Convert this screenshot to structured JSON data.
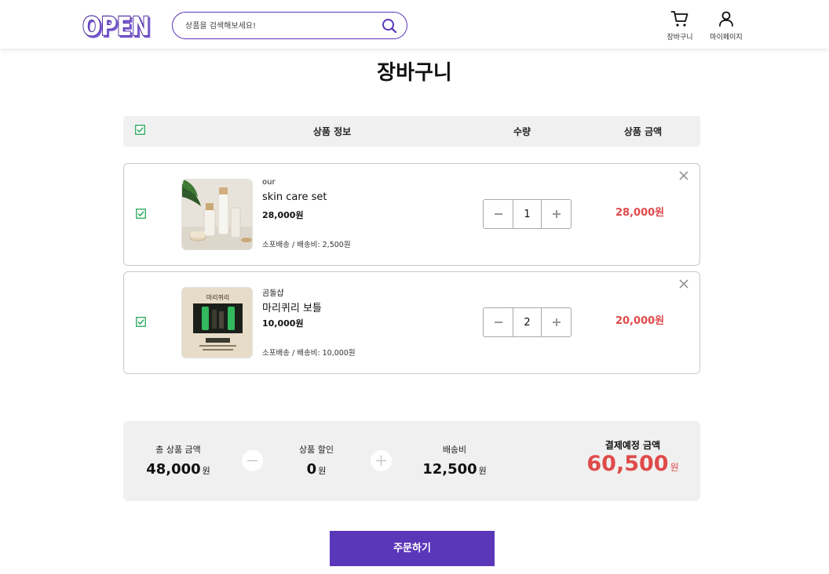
{
  "header": {
    "logo_text": "OPEN",
    "search": {
      "placeholder": "상품을 검색해보세요!",
      "value": ""
    },
    "cart_label": "장바구니",
    "mypage_label": "마이페이지"
  },
  "page": {
    "title": "장바구니"
  },
  "table_header": {
    "product_info": "상품 정보",
    "quantity": "수량",
    "product_amount": "상품 금액"
  },
  "items": [
    {
      "seller": "our",
      "name": "skin care set",
      "price": "28,000원",
      "shipping": "소포배송 / 배송비: 2,500원",
      "quantity": "1",
      "total": "28,000원",
      "checked": true
    },
    {
      "seller": "곰돌샵",
      "name": "마리퀴리 보틀",
      "price": "10,000원",
      "shipping": "소포배송 / 배송비: 10,000원",
      "quantity": "2",
      "total": "20,000원",
      "checked": true,
      "thumb_caption": "마리퀴리"
    }
  ],
  "summary": {
    "total_label": "총 상품 금액",
    "total_value": "48,000",
    "discount_label": "상품 할인",
    "discount_value": "0",
    "shipping_label": "배송비",
    "shipping_value": "12,500",
    "final_label": "결제예정 금액",
    "final_value": "60,500",
    "unit": "원"
  },
  "order_button": "주문하기",
  "colors": {
    "brand": "#5a36b8",
    "price_red": "#e04a4a",
    "checkbox_green": "#26a65b"
  },
  "icons": [
    "search-icon",
    "cart-icon",
    "user-icon",
    "checkbox-checked-icon",
    "minus-icon",
    "plus-icon",
    "close-icon"
  ]
}
